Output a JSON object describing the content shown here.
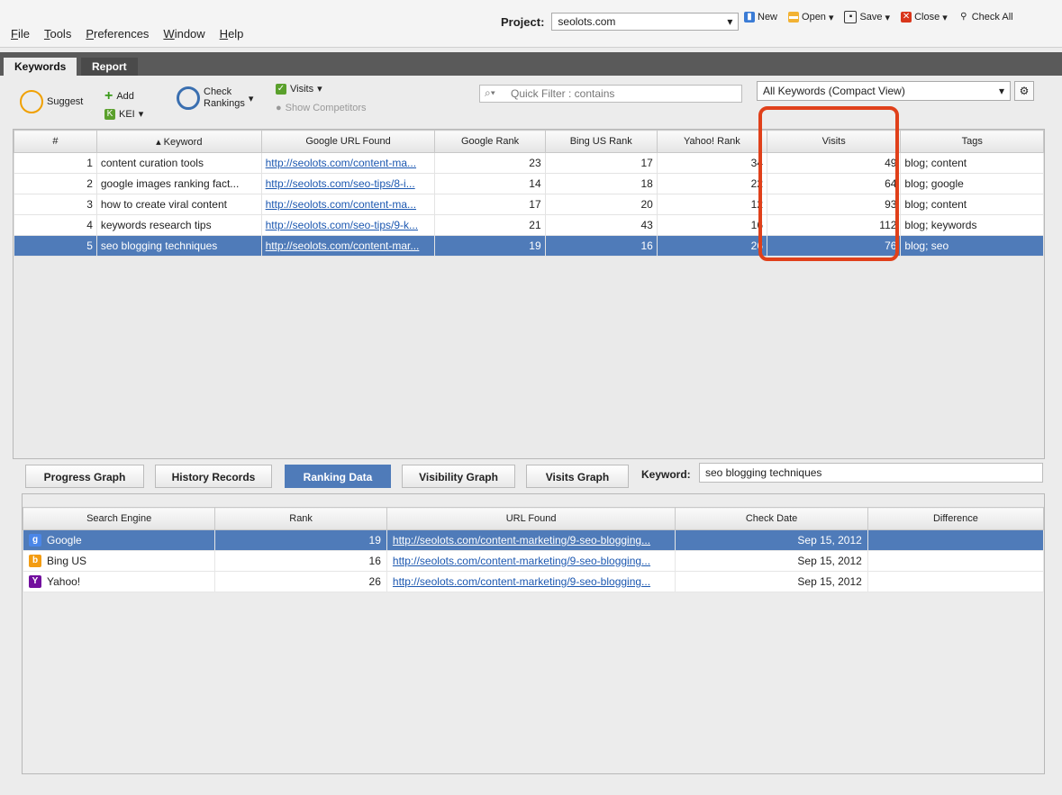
{
  "menu": [
    "File",
    "Tools",
    "Preferences",
    "Window",
    "Help"
  ],
  "project": {
    "label": "Project:",
    "value": "seolots.com"
  },
  "project_actions": [
    {
      "label": "New",
      "icon": "new-doc-icon"
    },
    {
      "label": "Open",
      "icon": "folder-icon"
    },
    {
      "label": "Save",
      "icon": "save-icon"
    },
    {
      "label": "Close",
      "icon": "close-icon"
    },
    {
      "label": "Check All",
      "icon": "check-all-icon"
    }
  ],
  "tabs": {
    "active": "Keywords",
    "other": "Report"
  },
  "toolbar": {
    "suggest": "Suggest",
    "add": "Add",
    "kei": "KEI",
    "check": "Check",
    "rankings": "Rankings",
    "visits": "Visits",
    "show_competitors": "Show Competitors",
    "quick_filter_placeholder": "Quick Filter : contains",
    "view": "All Keywords (Compact View)"
  },
  "keyword_table": {
    "columns": [
      "#",
      "Keyword",
      "Google URL Found",
      "Google Rank",
      "Bing US Rank",
      "Yahoo! Rank",
      "Visits",
      "Tags"
    ],
    "rows": [
      {
        "n": "1",
        "keyword": "content curation tools",
        "url": "http://seolots.com/content-ma...",
        "google": "23",
        "bing": "17",
        "yahoo": "34",
        "visits": "49",
        "tags": "blog; content"
      },
      {
        "n": "2",
        "keyword": "google images ranking fact...",
        "url": "http://seolots.com/seo-tips/8-i...",
        "google": "14",
        "bing": "18",
        "yahoo": "22",
        "visits": "64",
        "tags": "blog; google"
      },
      {
        "n": "3",
        "keyword": "how to create viral content",
        "url": "http://seolots.com/content-ma...",
        "google": "17",
        "bing": "20",
        "yahoo": "12",
        "visits": "93",
        "tags": "blog; content"
      },
      {
        "n": "4",
        "keyword": "keywords research tips",
        "url": "http://seolots.com/seo-tips/9-k...",
        "google": "21",
        "bing": "43",
        "yahoo": "16",
        "visits": "112",
        "tags": "blog; keywords"
      },
      {
        "n": "5",
        "keyword": "seo blogging techniques",
        "url": "http://seolots.com/content-mar...",
        "google": "19",
        "bing": "16",
        "yahoo": "26",
        "visits": "76",
        "tags": "blog; seo"
      }
    ]
  },
  "bottom_tabs": [
    "Progress Graph",
    "History Records",
    "Ranking Data",
    "Visibility Graph",
    "Visits Graph"
  ],
  "keyword_field": {
    "label": "Keyword:",
    "value": "seo blogging techniques"
  },
  "ranking_table": {
    "columns": [
      "Search Engine",
      "Rank",
      "URL Found",
      "Check Date",
      "Difference"
    ],
    "rows": [
      {
        "engine": "Google",
        "rank": "19",
        "url": "http://seolots.com/content-marketing/9-seo-blogging...",
        "date": "Sep 15, 2012",
        "diff": ""
      },
      {
        "engine": "Bing US",
        "rank": "16",
        "url": "http://seolots.com/content-marketing/9-seo-blogging...",
        "date": "Sep 15, 2012",
        "diff": ""
      },
      {
        "engine": "Yahoo!",
        "rank": "26",
        "url": "http://seolots.com/content-marketing/9-seo-blogging...",
        "date": "Sep 15, 2012",
        "diff": ""
      }
    ]
  },
  "colors": {
    "selection": "#4f7bb9",
    "highlight": "#e0401a",
    "link": "#1b57b0"
  }
}
